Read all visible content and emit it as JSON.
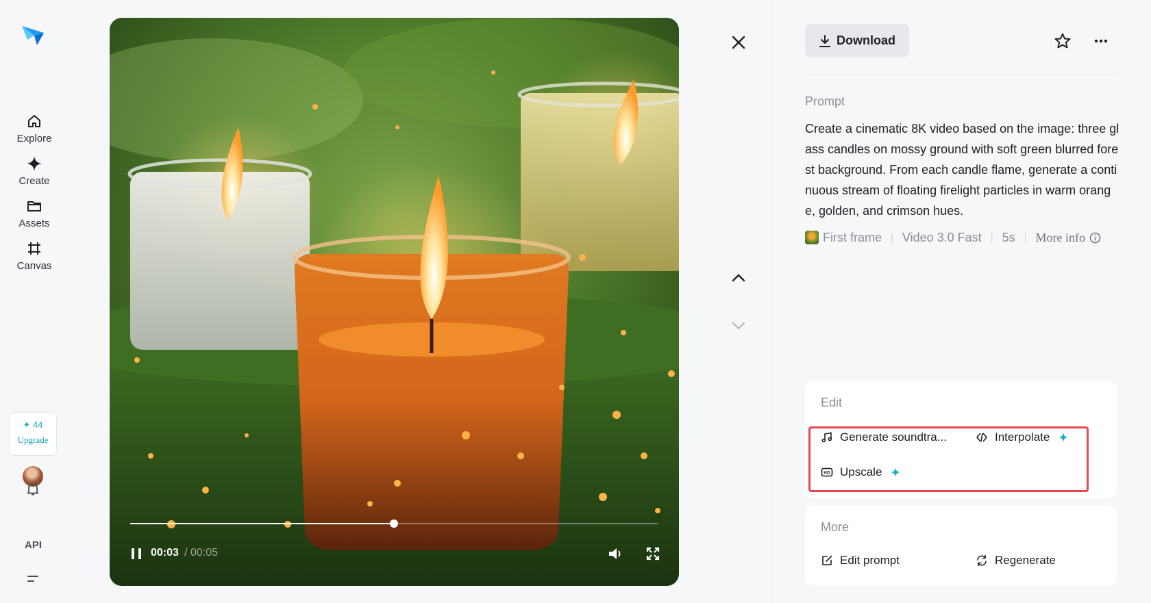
{
  "sidebar": {
    "nav": [
      {
        "label": "Explore",
        "icon": "home-icon"
      },
      {
        "label": "Create",
        "icon": "sparkle-icon"
      },
      {
        "label": "Assets",
        "icon": "folder-icon"
      },
      {
        "label": "Canvas",
        "icon": "frame-icon"
      }
    ],
    "credits": "44",
    "upgrade_label": "Upgrade",
    "api_label": "API"
  },
  "player": {
    "current_time": "00:03",
    "separator": "/",
    "total_time": "00:05",
    "progress": 0.5
  },
  "panel": {
    "download_label": "Download",
    "prompt_label": "Prompt",
    "prompt_text": "Create a cinematic 8K video based on the image: three glass candles on mossy ground with soft green blurred forest background. From each candle flame, generate a continuous stream of floating firelight particles in warm orange, golden, and crimson hues.",
    "meta": {
      "first_frame": "First frame",
      "model": "Video 3.0 Fast",
      "duration": "5s",
      "more_info": "More info"
    },
    "edit": {
      "title": "Edit",
      "generate_soundtrack": "Generate soundtra...",
      "interpolate": "Interpolate",
      "upscale": "Upscale"
    },
    "more": {
      "title": "More",
      "edit_prompt": "Edit prompt",
      "regenerate": "Regenerate"
    }
  },
  "colors": {
    "accent": "#12b0c6",
    "highlight": "#e5484d"
  }
}
